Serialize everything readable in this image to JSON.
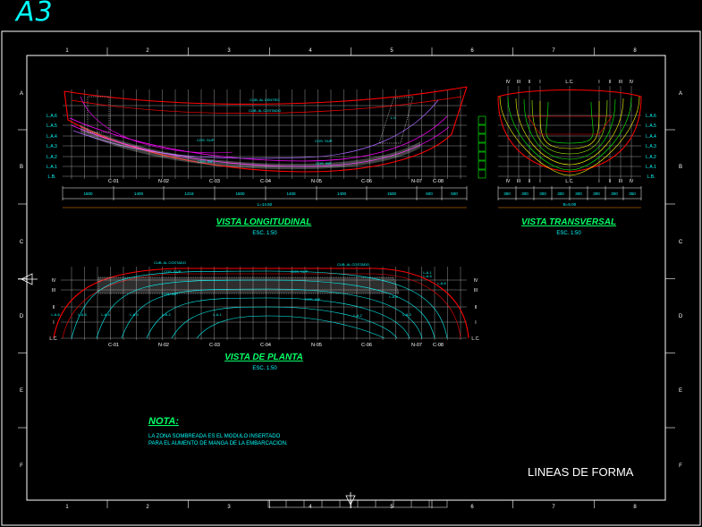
{
  "sheet": {
    "size_tag": "A3",
    "drawing_title": "LINEAS DE FORMA"
  },
  "grid": {
    "columns": [
      "1",
      "2",
      "3",
      "4",
      "5",
      "6",
      "7",
      "8"
    ],
    "rows": [
      "A",
      "B",
      "C",
      "D",
      "E",
      "F"
    ]
  },
  "colors": {
    "background": "#000000",
    "hull": "#ff0000",
    "grid": "#ffffff",
    "text": "#00ffff",
    "title": "#00ff66",
    "waterline": "#ff00ff",
    "station": "#ffff00",
    "green": "#00ff00"
  },
  "longitudinal": {
    "title": "VISTA LONGITUDINAL",
    "scale": "ESC. 1:50",
    "waterlines": [
      "L.A.6",
      "L.A.5",
      "L.A.4",
      "L.A.3",
      "L.A.2",
      "L.A.1",
      "L.B."
    ],
    "stations": [
      "C-01",
      "N-02",
      "C-03",
      "C-04",
      "N-05",
      "C-06",
      "N-07",
      "C-08"
    ],
    "notes": [
      "CUB. AL CENTRO",
      "CUB. AL COSTADO",
      "COS. SUP.",
      "COS. INF.",
      "COS. SUP.",
      "COS. INF.",
      "L.V."
    ],
    "spacings": [
      "1500",
      "1400",
      "1218",
      "1500",
      "1400",
      "1400",
      "1500",
      "500",
      "500"
    ],
    "total": "L=14.50"
  },
  "transversal": {
    "title": "VISTA TRANSVERSAL",
    "scale": "ESC. 1:50",
    "top_labels": [
      "IV",
      "III",
      "II",
      "I",
      "L.C.",
      "I",
      "II",
      "III",
      "IV"
    ],
    "waterlines": [
      "L.A.6",
      "L.A.5",
      "L.A.4",
      "L.A.3",
      "L.A.2",
      "L.A.1",
      "L.B."
    ],
    "bottom_labels": [
      "IV",
      "III",
      "II",
      "I",
      "L.C.",
      "I",
      "II",
      "III",
      "IV"
    ],
    "spacings": [
      "350",
      "300",
      "300",
      "300",
      "300",
      "300",
      "300",
      "350"
    ],
    "total": "B=5.00"
  },
  "plan": {
    "title": "VISTA DE PLANTA",
    "scale": "ESC. 1:50",
    "buttocks": [
      "IV",
      "III",
      "II",
      "I",
      "L.C."
    ],
    "stations": [
      "C-01",
      "N-02",
      "C-03",
      "C-04",
      "N-05",
      "C-06",
      "N-07",
      "C-08"
    ],
    "notes": [
      "CUB. AL COSTADO",
      "COS. SUP.",
      "COS. INF.",
      "CUB. AL COSTADO",
      "COS. SUP.",
      "COS. INF."
    ],
    "wl_labels": [
      "L.A.6",
      "L.A.5",
      "L.A.4",
      "L.A.3",
      "L.A.2",
      "L.A.1",
      "L.A.5",
      "L.A.6",
      "L.A.4",
      "L.A.3",
      "L.A.2",
      "L.A.1"
    ]
  },
  "note": {
    "title": "NOTA:",
    "line1": "LA ZONA SOMBREADA ES EL MODULO INSERTADO",
    "line2": "PARA EL AUMENTO DE MANGA DE LA EMBARCACION."
  }
}
